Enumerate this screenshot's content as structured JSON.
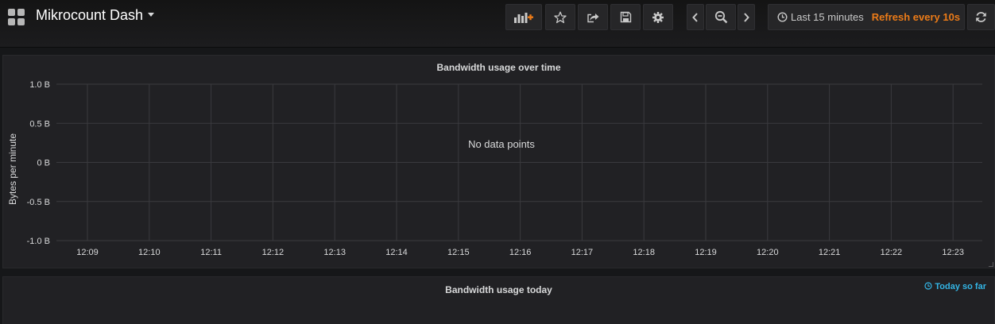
{
  "navbar": {
    "dashboard_title": "Mikrocount Dash",
    "buttons": {
      "add_panel": "add-panel-icon",
      "star": "star-icon",
      "share": "share-icon",
      "save": "save-icon",
      "settings": "gear-icon",
      "time_back": "chevron-left-icon",
      "zoom_out": "zoom-out-icon",
      "time_forward": "chevron-right-icon",
      "refresh": "refresh-icon"
    },
    "time_range": "Last 15 minutes",
    "refresh_interval": "Refresh every 10s"
  },
  "colors": {
    "page_background": "#161719",
    "panel_background": "#212124",
    "refresh_text": "#eb7b18",
    "info_text": "#33b5e5",
    "add_panel_accent": "#eb7b18"
  },
  "panels": [
    {
      "title": "Bandwidth usage over time",
      "message": "No data points"
    },
    {
      "title": "Bandwidth usage today",
      "info": "Today so far"
    }
  ],
  "chart_data": {
    "type": "line",
    "title": "Bandwidth usage over time",
    "ylabel": "Bytes per minute",
    "xlabel": "",
    "x_ticks": [
      "12:09",
      "12:10",
      "12:11",
      "12:12",
      "12:13",
      "12:14",
      "12:15",
      "12:16",
      "12:17",
      "12:18",
      "12:19",
      "12:20",
      "12:21",
      "12:22",
      "12:23"
    ],
    "y_ticks": [
      "1.0 B",
      "0.5 B",
      "0 B",
      "-0.5 B",
      "-1.0 B"
    ],
    "ylim": [
      -1.0,
      1.0
    ],
    "grid": true,
    "series": []
  }
}
